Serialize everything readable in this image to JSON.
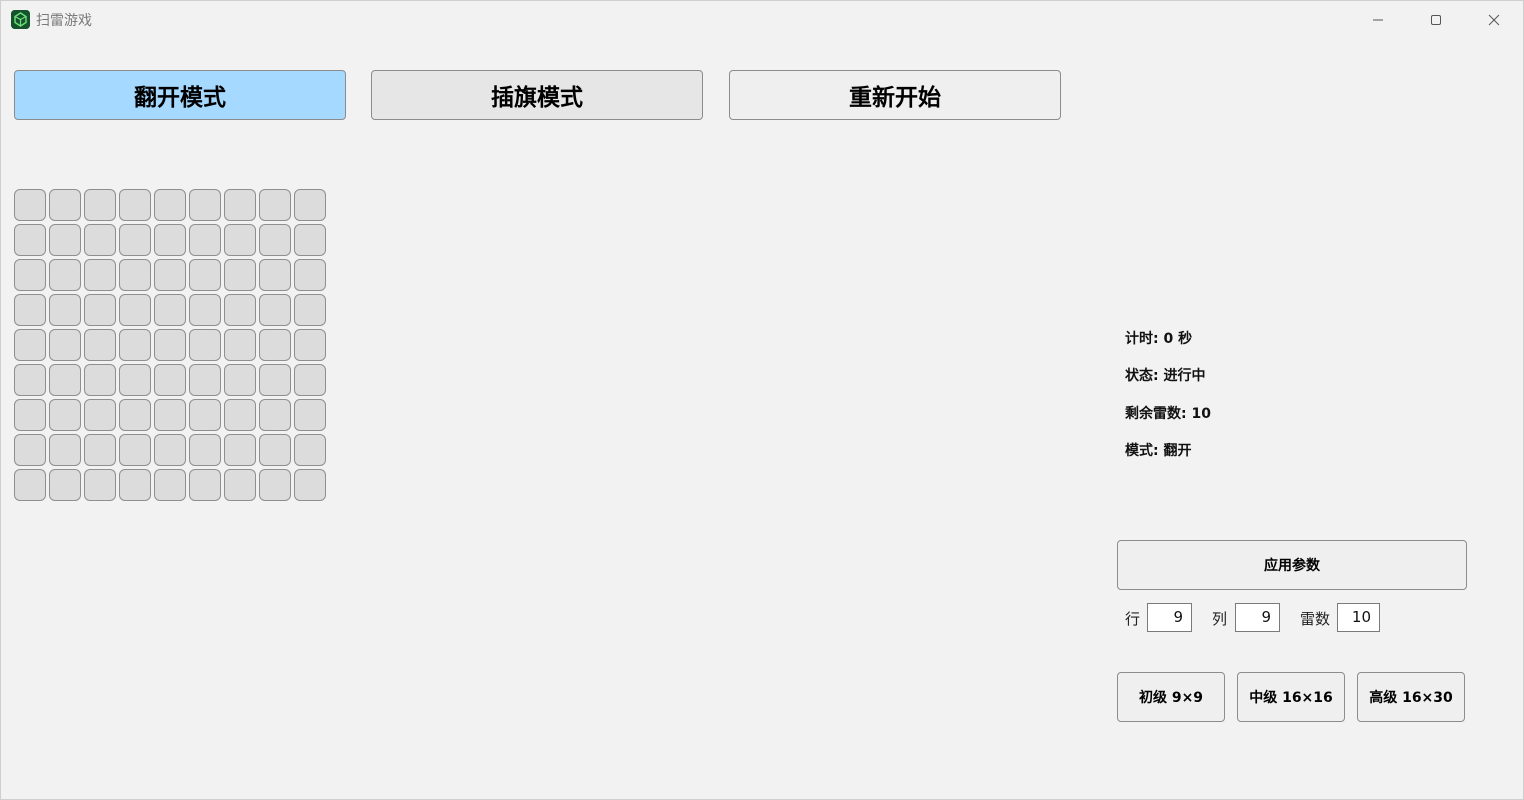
{
  "window": {
    "title": "扫雷游戏",
    "icon": "minesweeper-app-icon"
  },
  "toolbar": {
    "reveal_label": "翻开模式",
    "flag_label": "插旗模式",
    "restart_label": "重新开始"
  },
  "board": {
    "rows": 9,
    "cols": 9
  },
  "status": {
    "timer": "计时: 0 秒",
    "state": "状态: 进行中",
    "mines_left": "剩余雷数: 10",
    "mode": "模式: 翻开"
  },
  "params": {
    "apply_label": "应用参数",
    "rows_label": "行",
    "rows_value": "9",
    "cols_label": "列",
    "cols_value": "9",
    "mines_label": "雷数",
    "mines_value": "10"
  },
  "presets": {
    "easy": "初级 9×9",
    "medium": "中级 16×16",
    "hard": "高级 16×30"
  },
  "colors": {
    "active_mode_bg": "#a6d9ff",
    "cell_bg": "#dcdcdc",
    "window_bg": "#f2f2f2"
  }
}
